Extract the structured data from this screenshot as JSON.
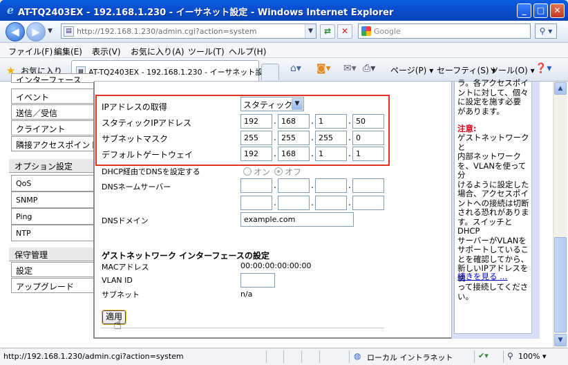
{
  "window": {
    "title": "AT-TQ2403EX - 192.168.1.230 - イーサネット設定 - Windows Internet Explorer",
    "minimize": "_",
    "maximize": "□",
    "close": "✕"
  },
  "address": {
    "url": "http://192.168.1.230/admin.cgi?action=system",
    "search_placeholder": "Google"
  },
  "menu": [
    "ファイル(F)",
    "編集(E)",
    "表示(V)",
    "お気に入り(A)",
    "ツール(T)",
    "ヘルプ(H)"
  ],
  "favorites": {
    "label": "お気に入り",
    "tab_title": "AT-TQ2403EX - 192.168.1.230 - イーサネット設...",
    "page_menu": "ページ(P)",
    "safety_menu": "セーフティ(S)",
    "tools_menu": "ツール(O)"
  },
  "sidebar": {
    "top_partial": "インターフェース",
    "items_group1": [
      "イベント",
      "送信／受信",
      "クライアント",
      "隣接アクセスポイント"
    ],
    "header_option": "オプション設定",
    "items_option": [
      "QoS",
      "SNMP",
      "Ping",
      "NTP"
    ],
    "header_maint": "保守管理",
    "items_maint": [
      "設定",
      "アップグレード"
    ]
  },
  "form": {
    "ip_mode_label": "IPアドレスの取得",
    "ip_mode_value": "スタティックIP",
    "static_ip_label": "スタティックIPアドレス",
    "static_ip": [
      "192",
      "168",
      "1",
      "50"
    ],
    "subnet_label": "サブネットマスク",
    "subnet": [
      "255",
      "255",
      "255",
      "0"
    ],
    "gateway_label": "デフォルトゲートウェイ",
    "gateway": [
      "192",
      "168",
      "1",
      "1"
    ],
    "dhcp_dns_label": "DHCP経由でDNSを設定する",
    "dhcp_dns_on": "オン",
    "dhcp_dns_off": "オフ",
    "dns_servers_label": "DNSネームサーバー",
    "dns_domain_label": "DNSドメイン",
    "dns_domain_value": "example.com",
    "guest_title": "ゲストネットワーク インターフェースの設定",
    "mac_label": "MACアドレス",
    "mac_value": "00:00:00:00:00:00",
    "vlan_label": "VLAN ID",
    "vlan_value": "",
    "subnet2_label": "サブネット",
    "subnet2_value": "n/a",
    "apply_label": "適用"
  },
  "help": {
    "top_lines": [
      "ラ。各アクセスポイ",
      "ントに対して、個々",
      "に設定を施す必要",
      "があります。"
    ],
    "caution_title": "注意:",
    "caution_lines": [
      "ゲストネットワークと",
      "内部ネットワーク",
      "を、VLANを使って分",
      "けるように設定した",
      "場合、アクセスポイ",
      "ントへの接続は切断",
      "される恐れがありま",
      "す。スイッチとDHCP",
      "サーバーがVLANを",
      "サポートしているこ",
      "とを確認してから、",
      "新しいIPアドレスを使",
      "って接続してくださ",
      "い。"
    ],
    "more_link": "続きを見る ..."
  },
  "status": {
    "url": "http://192.168.1.230/admin.cgi?action=system",
    "zone": "ローカル イントラネット",
    "zoom": "100%"
  },
  "colors": {
    "highlight_border": "#e0301e",
    "caution_red": "#e0001b",
    "link_blue": "#0000cc"
  }
}
